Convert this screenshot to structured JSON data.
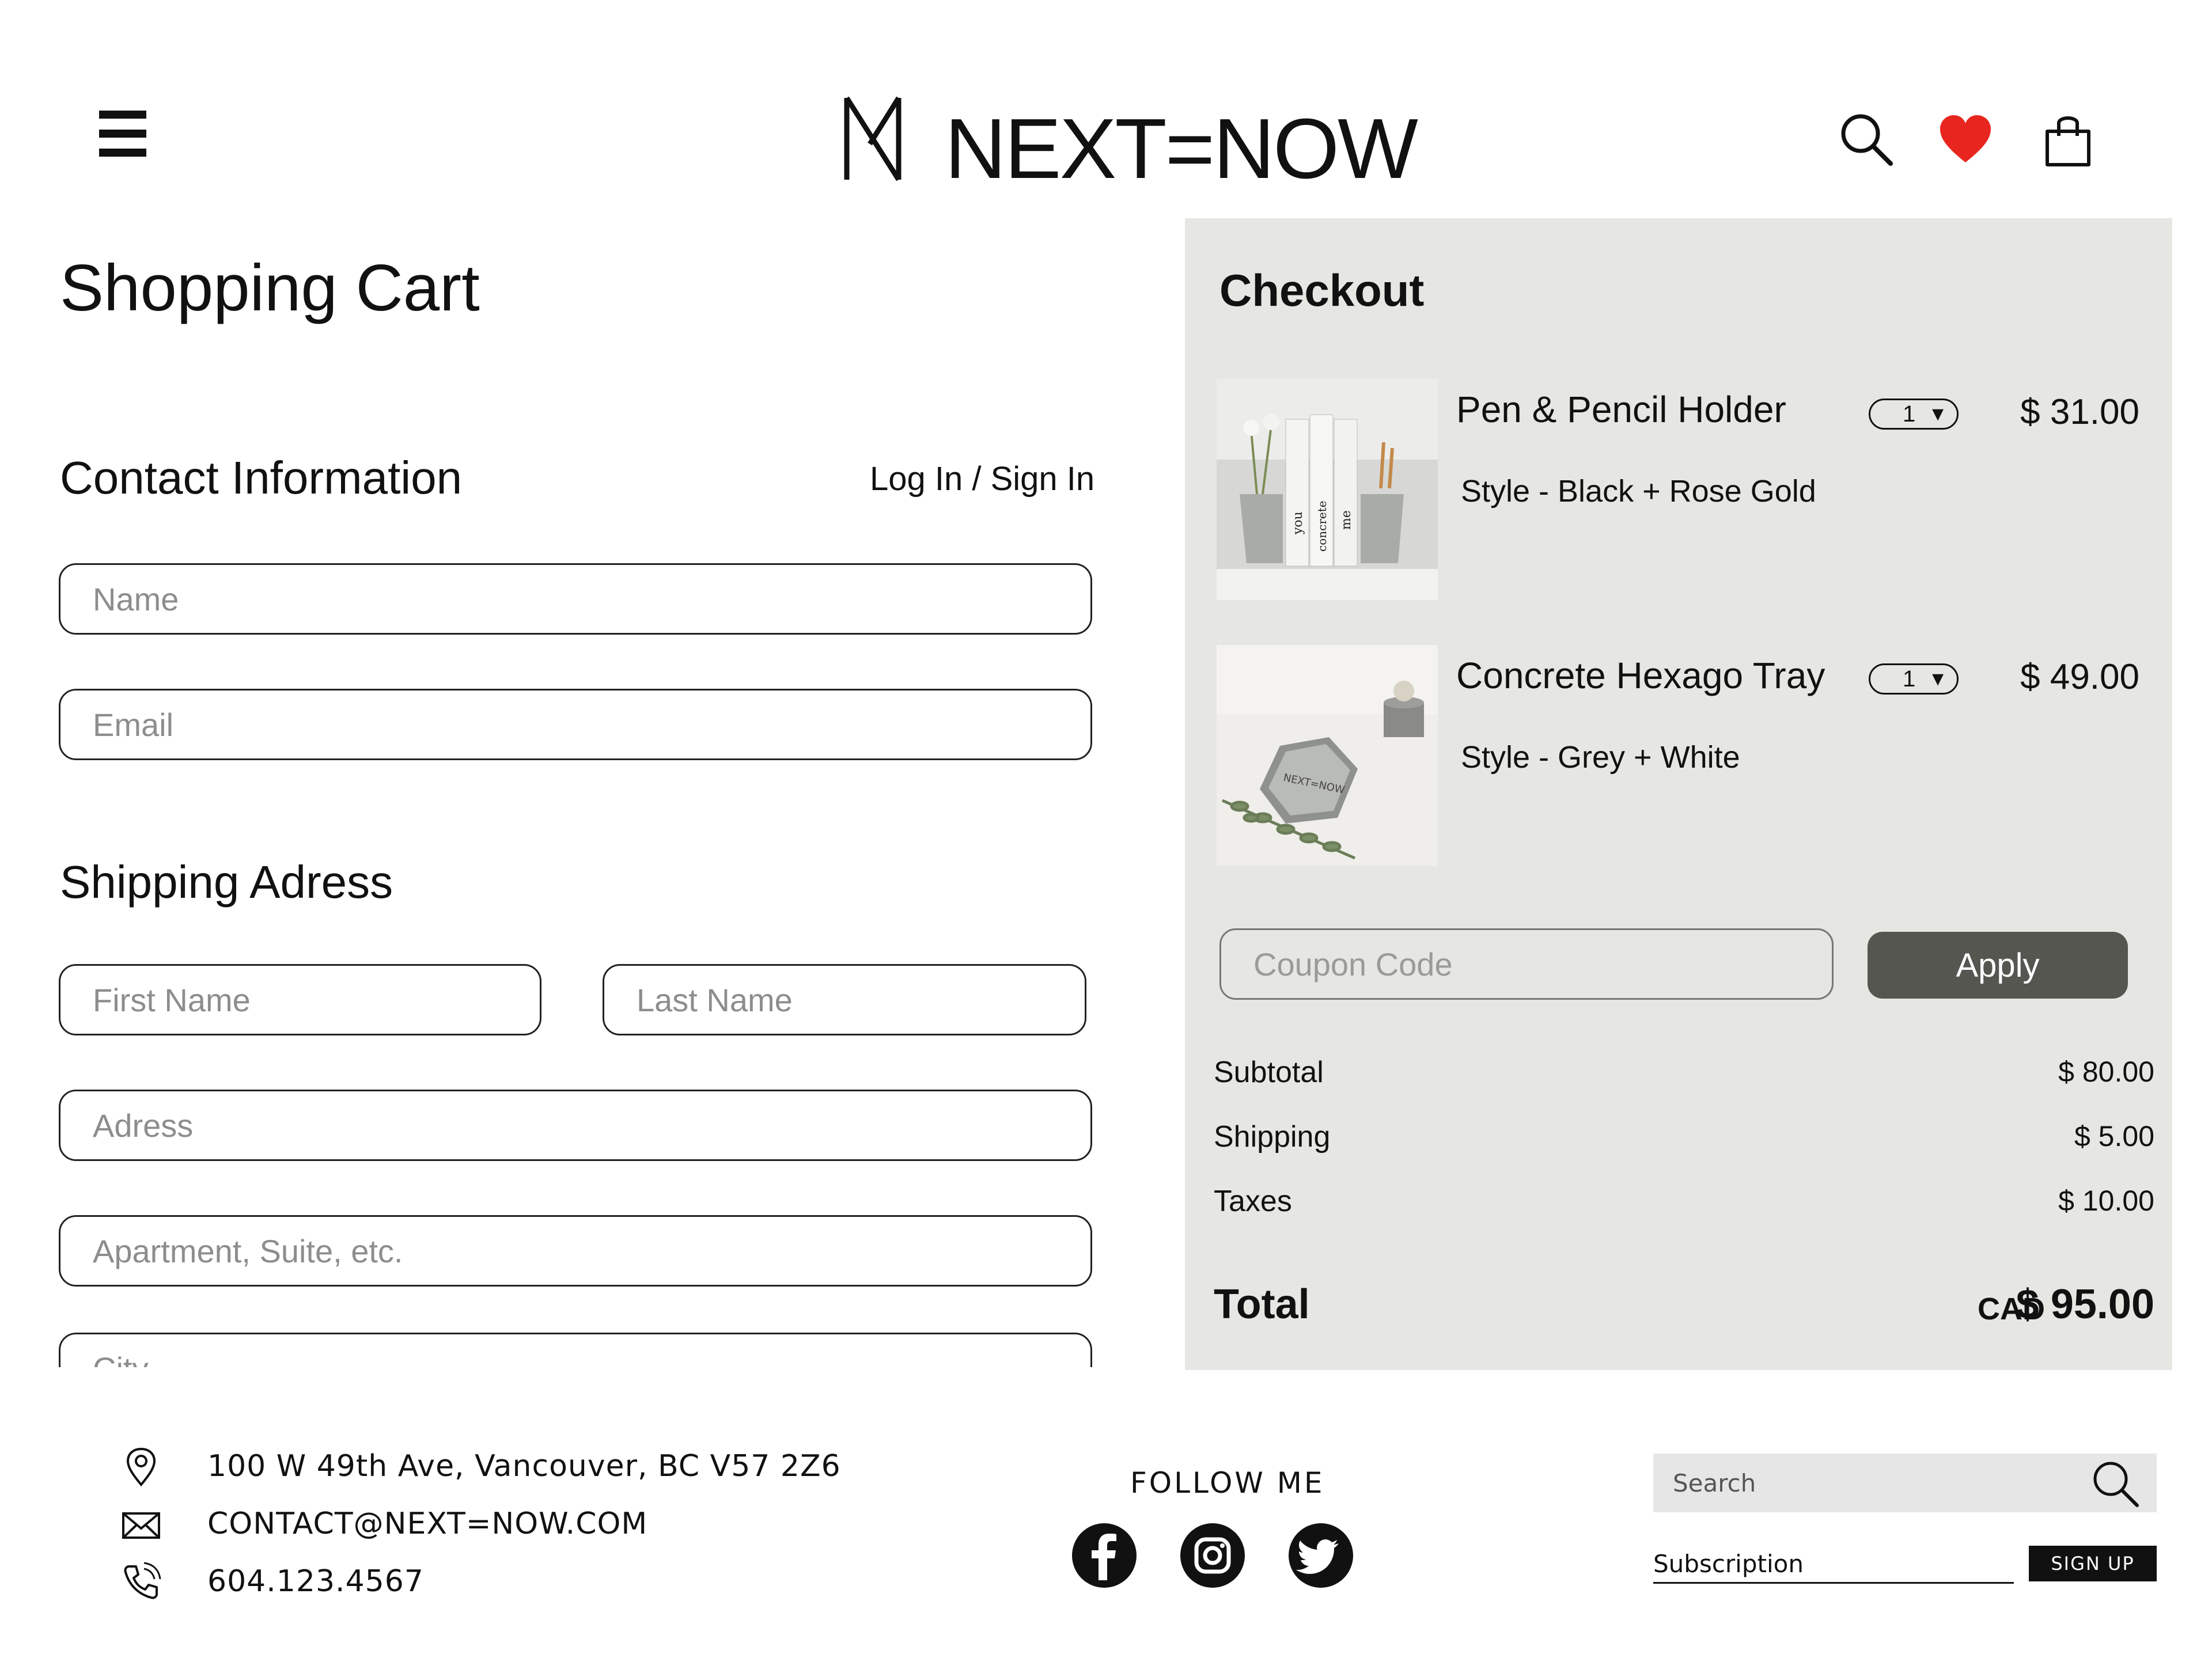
{
  "header": {
    "brand_name": "NEXT=NOW",
    "icons": {
      "menu": "hamburger-icon",
      "search": "search-icon",
      "wishlist": "heart-icon",
      "cart": "shopping-bag-icon"
    },
    "wishlist_color": "#e8261f"
  },
  "page_title": "Shopping Cart",
  "contact": {
    "title": "Contact Information",
    "login_link": "Log In / Sign In",
    "name_placeholder": "Name",
    "email_placeholder": "Email"
  },
  "shipping": {
    "title": "Shipping Adress",
    "first_name_placeholder": "First Name",
    "last_name_placeholder": "Last Name",
    "address_placeholder": "Adress",
    "apartment_placeholder": "Apartment, Suite, etc.",
    "city_placeholder": "City"
  },
  "checkout": {
    "title": "Checkout",
    "panel_color": "#e6e7e3",
    "items": [
      {
        "name": "Pen & Pencil Holder",
        "style": "Style - Black + Rose Gold",
        "qty": "1",
        "price": "$ 31.00",
        "book_spines": [
          "you",
          "concrete",
          "me"
        ]
      },
      {
        "name": "Concrete Hexago Tray",
        "style": "Style - Grey + White",
        "qty": "1",
        "price": "$ 49.00",
        "tray_label": "NEXT=NOW"
      }
    ],
    "coupon_placeholder": "Coupon Code",
    "apply_label": "Apply",
    "summary": [
      {
        "label": "Subtotal",
        "value": "$ 80.00"
      },
      {
        "label": "Shipping",
        "value": "$ 5.00"
      },
      {
        "label": "Taxes",
        "value": "$ 10.00"
      }
    ],
    "total_label": "Total",
    "total_currency": "CAD",
    "total_value": "$ 95.00"
  },
  "footer": {
    "address": "100 W 49th Ave, Vancouver, BC  V57 2Z6",
    "email": "CONTACT@NEXT=NOW.COM",
    "phone": "604.123.4567",
    "follow_label": "FOLLOW ME",
    "social": [
      "facebook-icon",
      "instagram-icon",
      "twitter-icon"
    ],
    "search_placeholder": "Search",
    "subscription_placeholder": "Subscription",
    "signup_label": "SIGN UP"
  }
}
